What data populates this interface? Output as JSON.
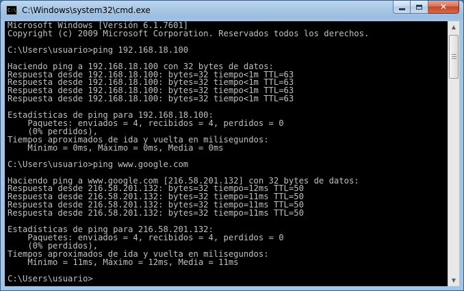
{
  "window": {
    "title": "C:\\Windows\\system32\\cmd.exe",
    "icon": "cmd-console-icon",
    "icon_text": "C:\\",
    "close_glyph": "✕"
  },
  "console": {
    "lines": [
      "Microsoft Windows [Versión 6.1.7601]",
      "Copyright (c) 2009 Microsoft Corporation. Reservados todos los derechos.",
      "",
      "C:\\Users\\usuario>ping 192.168.18.100",
      "",
      "Haciendo ping a 192.168.18.100 con 32 bytes de datos:",
      "Respuesta desde 192.168.18.100: bytes=32 tiempo<1m TTL=63",
      "Respuesta desde 192.168.18.100: bytes=32 tiempo<1m TTL=63",
      "Respuesta desde 192.168.18.100: bytes=32 tiempo<1m TTL=63",
      "Respuesta desde 192.168.18.100: bytes=32 tiempo<1m TTL=63",
      "",
      "Estadísticas de ping para 192.168.18.100:",
      "    Paquetes: enviados = 4, recibidos = 4, perdidos = 0",
      "    (0% perdidos),",
      "Tiempos aproximados de ida y vuelta en milisegundos:",
      "    Mínimo = 0ms, Máximo = 0ms, Media = 0ms",
      "",
      "C:\\Users\\usuario>ping www.google.com",
      "",
      "Haciendo ping a www.google.com [216.58.201.132] con 32 bytes de datos:",
      "Respuesta desde 216.58.201.132: bytes=32 tiempo=12ms TTL=50",
      "Respuesta desde 216.58.201.132: bytes=32 tiempo=11ms TTL=50",
      "Respuesta desde 216.58.201.132: bytes=32 tiempo=11ms TTL=50",
      "Respuesta desde 216.58.201.132: bytes=32 tiempo=11ms TTL=50",
      "",
      "Estadísticas de ping para 216.58.201.132:",
      "    Paquetes: enviados = 4, recibidos = 4, perdidos = 0",
      "    (0% perdidos),",
      "Tiempos aproximados de ida y vuelta en milisegundos:",
      "    Mínimo = 11ms, Máximo = 12ms, Media = 11ms",
      "",
      "C:\\Users\\usuario>"
    ],
    "background": "#000000",
    "foreground": "#c0c0c0"
  },
  "scrollbar": {
    "up_glyph": "▲",
    "down_glyph": "▼"
  }
}
